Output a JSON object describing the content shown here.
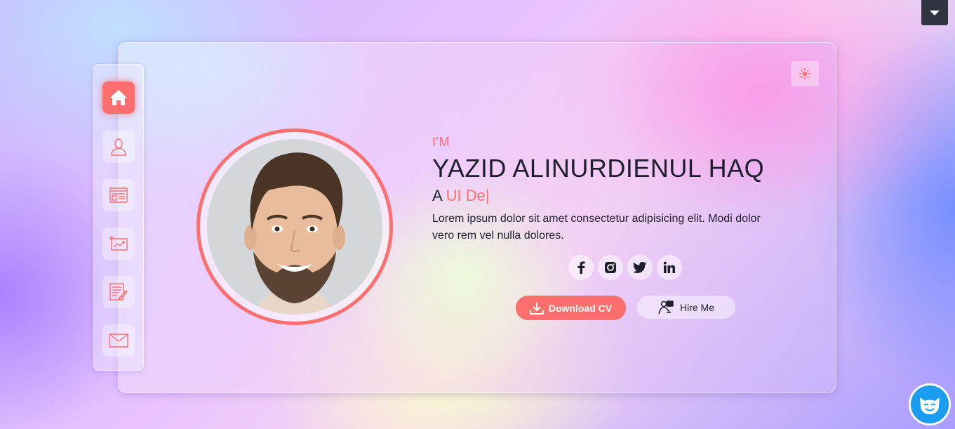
{
  "hero": {
    "greeting": "I'M",
    "name": "YAZID ALINURDIENUL HAQ",
    "role_prefix": "A",
    "role_typed": "UI De",
    "caret": "|",
    "description": "Lorem ipsum dolor sit amet consectetur adipisicing elit. Modi dolor vero rem vel nulla dolores."
  },
  "buttons": {
    "download_label": "Download CV",
    "hire_label": "Hire Me"
  },
  "sidebar": {
    "items": [
      {
        "icon": "home-icon",
        "active": true
      },
      {
        "icon": "user-icon",
        "active": false
      },
      {
        "icon": "id-card-icon",
        "active": false
      },
      {
        "icon": "chart-icon",
        "active": false
      },
      {
        "icon": "document-edit-icon",
        "active": false
      },
      {
        "icon": "mail-icon",
        "active": false
      }
    ]
  },
  "social": [
    "facebook-icon",
    "instagram-icon",
    "twitter-icon",
    "linkedin-icon"
  ],
  "colors": {
    "accent": "#fd6f6f",
    "text_dark": "#1e1e2f",
    "chat_widget": "#1a9cf0"
  }
}
